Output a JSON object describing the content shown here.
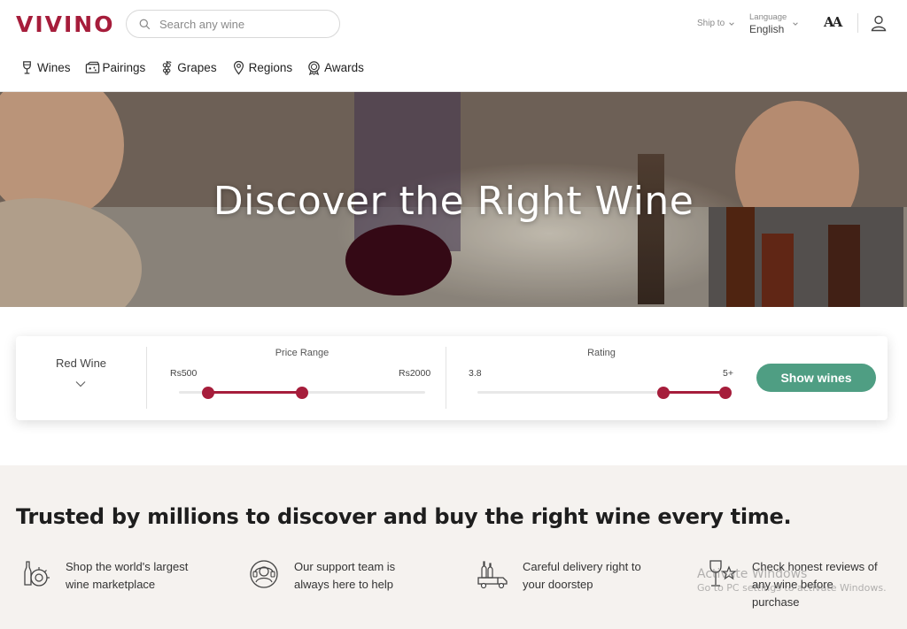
{
  "brand": {
    "logo_text": "VIVINO",
    "accent_color": "#a61d3b",
    "cta_color": "#4f9e83"
  },
  "search": {
    "placeholder": "Search any wine"
  },
  "header": {
    "ship_to_label": "Ship to",
    "language_label": "Language",
    "language_value": "English",
    "text_size_label": "AA"
  },
  "nav": {
    "items": [
      {
        "label": "Wines",
        "icon": "wine-glass-icon"
      },
      {
        "label": "Pairings",
        "icon": "pairings-icon"
      },
      {
        "label": "Grapes",
        "icon": "grapes-icon"
      },
      {
        "label": "Regions",
        "icon": "map-pin-icon"
      },
      {
        "label": "Awards",
        "icon": "award-icon"
      }
    ]
  },
  "hero": {
    "title": "Discover the Right Wine"
  },
  "filter": {
    "wine_type": "Red Wine",
    "price": {
      "title": "Price Range",
      "min_label": "Rs500",
      "max_label": "Rs2000",
      "low_fraction": 0.12,
      "high_fraction": 0.5
    },
    "rating": {
      "title": "Rating",
      "min_label": "3.8",
      "max_label": "5+",
      "low_fraction": 0.75,
      "high_fraction": 1.0
    },
    "show_button": "Show wines"
  },
  "trusted": {
    "title": "Trusted by millions to discover and buy the right wine every time.",
    "features": [
      {
        "line1": "Shop the world's largest",
        "line2": "wine marketplace",
        "line3": "",
        "icon": "bottles-icon"
      },
      {
        "line1": "Our support team is",
        "line2": "always here to help",
        "line3": "",
        "icon": "support-icon"
      },
      {
        "line1": "Careful delivery right to",
        "line2": "your doorstep",
        "line3": "",
        "icon": "delivery-truck-icon"
      },
      {
        "line1": "Check honest reviews of",
        "line2": "any wine before",
        "line3": "purchase",
        "icon": "review-glass-icon"
      }
    ]
  },
  "watermark": {
    "line1": "Activate Windows",
    "line2": "Go to PC settings to activate Windows."
  }
}
